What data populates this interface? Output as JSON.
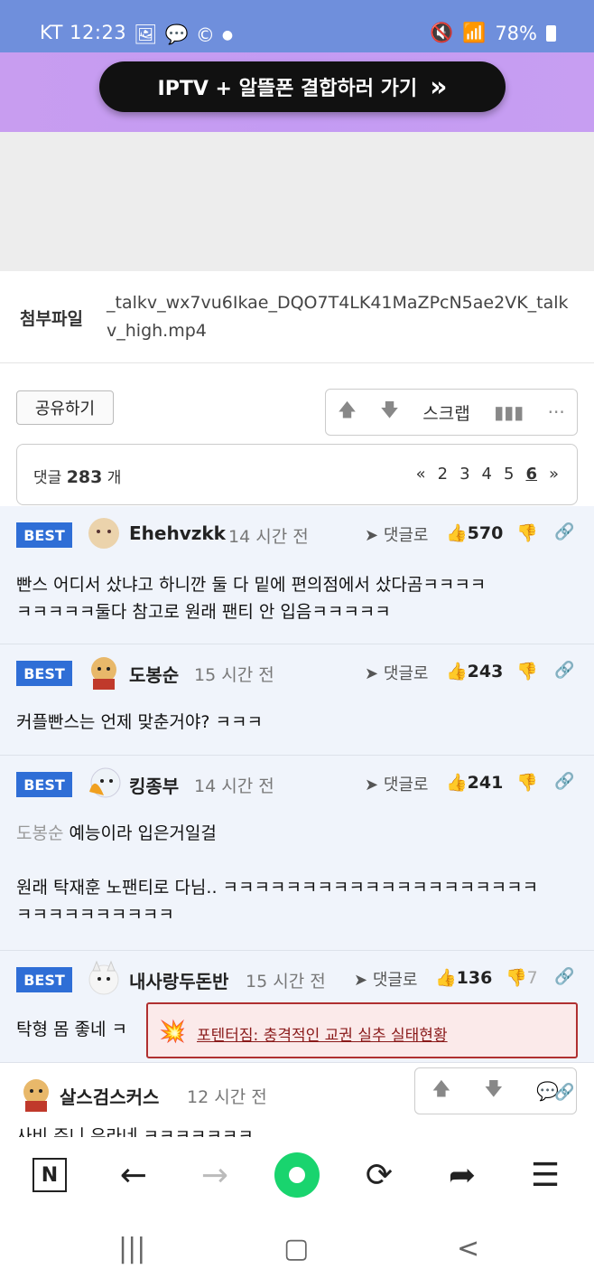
{
  "status_bar": {
    "carrier_time": "KT 12:23",
    "battery": "78%",
    "icons": [
      "gallery-icon",
      "chat-icon",
      "c-icon",
      "dot-icon",
      "mute-icon",
      "wifi-icon",
      "hd-icon",
      "signal-icon",
      "battery-icon"
    ]
  },
  "banner": {
    "text": "IPTV + 알뜰폰 결합하러 가기",
    "arrow": "»"
  },
  "attachment": {
    "label": "첨부파일",
    "filename": "_talkv_wx7vu6Ikae_DQO7T4LK41MaZPcN5ae2VK_talkv_high.mp4"
  },
  "actions": {
    "share": "공유하기",
    "scrap": "스크랩",
    "more": "···"
  },
  "comments_header": {
    "prefix": "댓글",
    "count": "283",
    "suffix": "개",
    "pages": [
      "«",
      "2",
      "3",
      "4",
      "5",
      "6",
      "»"
    ],
    "current_page": "6"
  },
  "comments": [
    {
      "badge": "BEST",
      "nick": "Ehehvzkk",
      "time": "14 시간 전",
      "reply": "댓글로",
      "likes": "570",
      "dislikes": "",
      "lines": [
        "빤스 어디서 샀냐고 하니깐 둘 다 밑에 편의점에서 샀다곰ㅋㅋㅋㅋ",
        "ㅋㅋㅋㅋㅋ둘다 참고로 원래 팬티 안 입음ㅋㅋㅋㅋㅋ"
      ]
    },
    {
      "badge": "BEST",
      "nick": "도봉순",
      "time": "15 시간 전",
      "reply": "댓글로",
      "likes": "243",
      "dislikes": "",
      "lines": [
        "커플빤스는 언제 맞춘거야? ㅋㅋㅋ"
      ]
    },
    {
      "badge": "BEST",
      "nick": "킹종부",
      "time": "14 시간 전",
      "reply": "댓글로",
      "likes": "241",
      "dislikes": "",
      "mention": "도봉순",
      "lines": [
        "예능이라 입은거일걸",
        "",
        "원래 탁재훈 노팬티로 다님.. ㅋㅋㅋㅋㅋㅋㅋㅋㅋㅋㅋㅋㅋㅋㅋㅋㅋㅋㅋㅋ",
        "ㅋㅋㅋㅋㅋㅋㅋㅋㅋㅋ"
      ]
    },
    {
      "badge": "BEST",
      "nick": "내사랑두돈반",
      "time": "15 시간 전",
      "reply": "댓글로",
      "likes": "136",
      "dislikes": "7",
      "lines": [
        "탁형 몸 좋네 ㅋ"
      ]
    },
    {
      "badge": "",
      "nick": "살스검스커스",
      "time": "12 시간 전",
      "lines": [
        "사비 주니 유라네 ㅋㅋㅋㅋㅋㅋㅋ"
      ]
    }
  ],
  "toast": {
    "text": "포텐터짐: 충격적인 교권 실추 실태현황"
  },
  "browser_nav": [
    "N",
    "←",
    "→",
    "●",
    "⟳",
    "➦",
    "☰"
  ],
  "system_nav": [
    "|||",
    "▢",
    "<"
  ]
}
